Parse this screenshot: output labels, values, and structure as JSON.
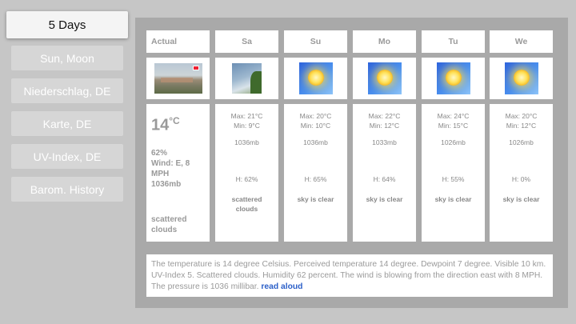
{
  "menu": {
    "items": [
      {
        "label": "5 Days",
        "active": true
      },
      {
        "label": "Sun, Moon"
      },
      {
        "label": "Niederschlag, DE"
      },
      {
        "label": "Karte, DE"
      },
      {
        "label": "UV-Index, DE"
      },
      {
        "label": "Barom. History"
      }
    ]
  },
  "current": {
    "header": "Actual",
    "image_icon": "city-photo-icon",
    "temperature": "14",
    "unit": "°C",
    "humidity": "62%",
    "wind": "Wind: E, 8",
    "wind_unit": "MPH",
    "pressure": "1036mb",
    "description_line1": "scattered",
    "description_line2": "clouds"
  },
  "forecast": [
    {
      "day": "Sa",
      "icon": "scattered-clouds-icon",
      "max": "Max: 21°C",
      "min": "Min: 9°C",
      "pressure": "1036mb",
      "humidity": "H: 62%",
      "desc1": "scattered",
      "desc2": "clouds"
    },
    {
      "day": "Su",
      "icon": "sun-icon",
      "max": "Max: 20°C",
      "min": "Min: 10°C",
      "pressure": "1036mb",
      "humidity": "H: 65%",
      "desc1": "sky is clear",
      "desc2": ""
    },
    {
      "day": "Mo",
      "icon": "sun-icon",
      "max": "Max: 22°C",
      "min": "Min: 12°C",
      "pressure": "1033mb",
      "humidity": "H: 64%",
      "desc1": "sky is clear",
      "desc2": ""
    },
    {
      "day": "Tu",
      "icon": "sun-icon",
      "max": "Max: 24°C",
      "min": "Min: 15°C",
      "pressure": "1026mb",
      "humidity": "H: 55%",
      "desc1": "sky is clear",
      "desc2": ""
    },
    {
      "day": "We",
      "icon": "sun-icon",
      "max": "Max: 20°C",
      "min": "Min: 12°C",
      "pressure": "1026mb",
      "humidity": "H: 0%",
      "desc1": "sky is clear",
      "desc2": ""
    }
  ],
  "summary": {
    "text": "The temperature is 14 degree Celsius. Perceived temperature 14 degree. Dewpoint 7 degree. Visible 10 km. UV-Index 5. Scattered clouds. Humidity 62 percent. The wind is blowing from the direction east with 8 MPH. The pressure is 1036 millibar.",
    "read_aloud": "read aloud"
  },
  "colors": {
    "background": "#c6c6c6",
    "panel": "#a9a9a9",
    "link": "#2b5fc8"
  }
}
